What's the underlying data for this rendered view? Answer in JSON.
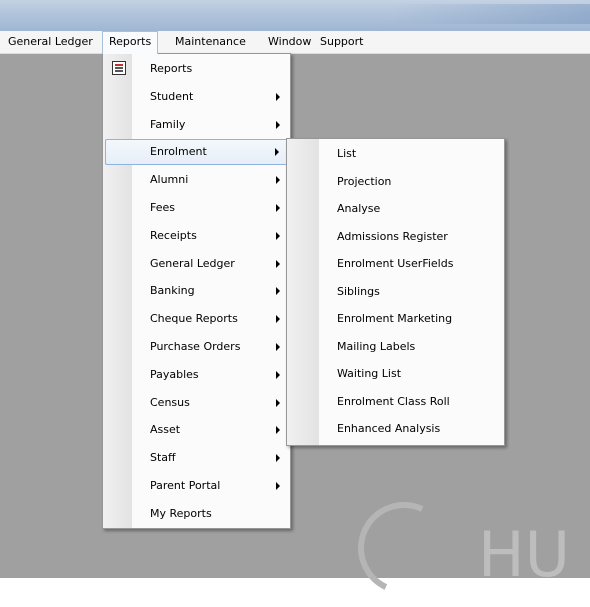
{
  "menubar": {
    "items": [
      "General Ledger",
      "Reports",
      "Maintenance",
      "Window",
      "Support"
    ]
  },
  "reports_menu": {
    "items": [
      {
        "label": "Reports",
        "icon": "report-icon"
      },
      {
        "label": "Student",
        "submenu": true
      },
      {
        "label": "Family",
        "submenu": true
      },
      {
        "label": "Enrolment",
        "submenu": true,
        "highlighted": true
      },
      {
        "label": "Alumni",
        "submenu": true
      },
      {
        "label": "Fees",
        "submenu": true
      },
      {
        "label": "Receipts",
        "submenu": true
      },
      {
        "label": "General Ledger",
        "submenu": true
      },
      {
        "label": "Banking",
        "submenu": true
      },
      {
        "label": "Cheque Reports",
        "submenu": true
      },
      {
        "label": "Purchase Orders",
        "submenu": true
      },
      {
        "label": "Payables",
        "submenu": true
      },
      {
        "label": "Census",
        "submenu": true
      },
      {
        "label": "Asset",
        "submenu": true
      },
      {
        "label": "Staff",
        "submenu": true
      },
      {
        "label": "Parent Portal",
        "submenu": true
      },
      {
        "label": "My Reports"
      }
    ]
  },
  "enrolment_submenu": {
    "items": [
      "List",
      "Projection",
      "Analyse",
      "Admissions Register",
      "Enrolment UserFields",
      "Siblings",
      "Enrolment Marketing",
      "Mailing Labels",
      "Waiting List",
      "Enrolment Class Roll",
      "Enhanced Analysis"
    ]
  },
  "watermark": "HU",
  "colors": {
    "titlebar": "#b3c5dc",
    "workspace": "#a0a0a0",
    "menu_bg": "#fbfbfb",
    "highlight_border": "#8fb3dc"
  }
}
